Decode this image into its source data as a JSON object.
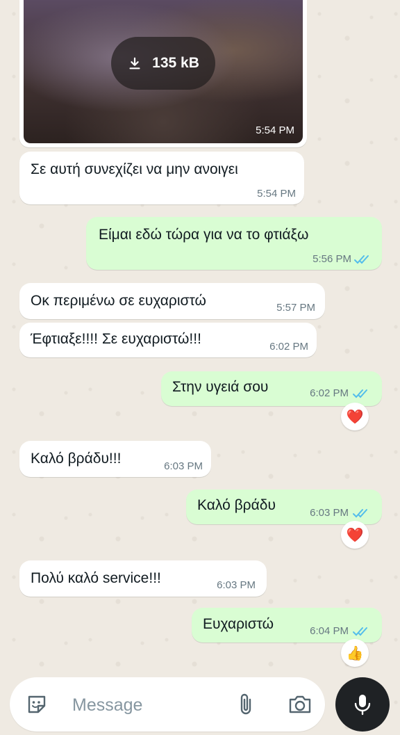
{
  "chat": {
    "image_message": {
      "download_size": "135 kB",
      "time": "5:54 PM",
      "download_icon": "download-icon"
    },
    "messages": [
      {
        "text": "Σε αυτή συνεχίζει να μην ανοιγει",
        "time": "5:54 PM",
        "direction": "incoming"
      },
      {
        "text": "Είμαι εδώ τώρα για να το φτιάξω",
        "time": "5:56 PM",
        "direction": "outgoing",
        "status": "read"
      },
      {
        "text": "Οκ περιμένω σε ευχαριστώ",
        "time": "5:57 PM",
        "direction": "incoming"
      },
      {
        "text": "Έφτιαξε!!!! Σε ευχαριστώ!!!",
        "time": "6:02 PM",
        "direction": "incoming"
      },
      {
        "text": "Στην υγειά σου",
        "time": "6:02 PM",
        "direction": "outgoing",
        "status": "read",
        "reaction": "❤️"
      },
      {
        "text": "Καλό βράδυ!!!",
        "time": "6:03 PM",
        "direction": "incoming"
      },
      {
        "text": "Καλό βράδυ",
        "time": "6:03 PM",
        "direction": "outgoing",
        "status": "read",
        "reaction": "❤️"
      },
      {
        "text": "Πολύ καλό service!!!",
        "time": "6:03 PM",
        "direction": "incoming"
      },
      {
        "text": "Ευχαριστώ",
        "time": "6:04 PM",
        "direction": "outgoing",
        "status": "read",
        "reaction": "👍"
      }
    ]
  },
  "composer": {
    "placeholder": "Message",
    "icons": [
      "sticker-icon",
      "attach-icon",
      "camera-icon",
      "mic-icon"
    ]
  },
  "colors": {
    "background": "#efeae2",
    "incoming_bubble": "#ffffff",
    "outgoing_bubble": "#d9fdd3",
    "read_ticks": "#53bdeb",
    "time_text": "#667781",
    "mic_button": "#1f2225"
  }
}
